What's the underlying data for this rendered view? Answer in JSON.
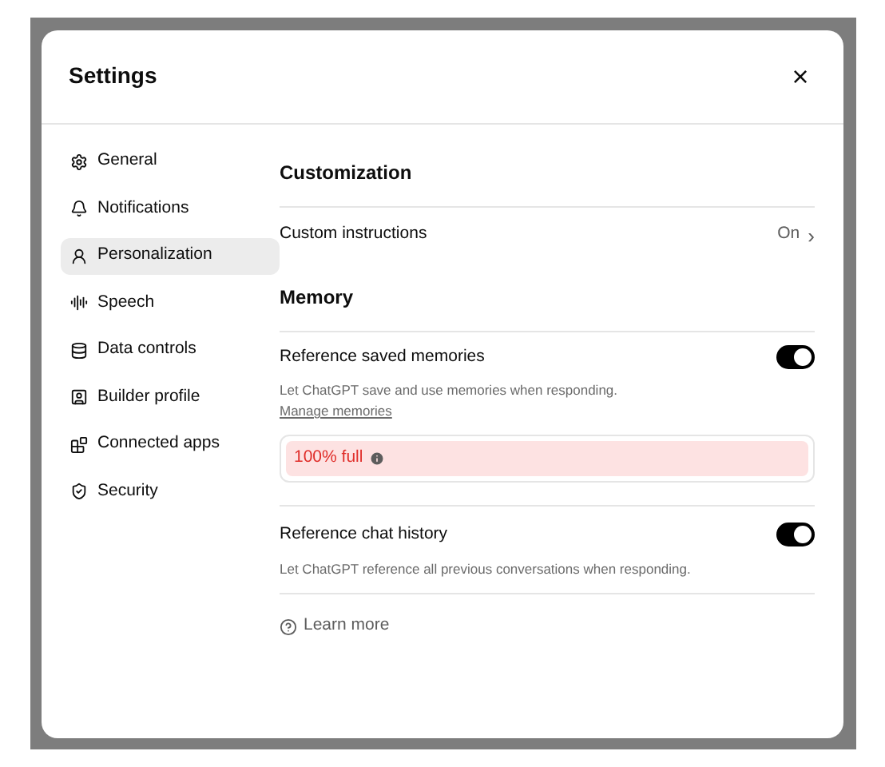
{
  "dialog": {
    "title": "Settings",
    "close": "×"
  },
  "sidebar": {
    "items": [
      {
        "label": "General",
        "selected": false
      },
      {
        "label": "Notifications",
        "selected": false
      },
      {
        "label": "Personalization",
        "selected": true
      },
      {
        "label": "Speech",
        "selected": false
      },
      {
        "label": "Data controls",
        "selected": false
      },
      {
        "label": "Builder profile",
        "selected": false
      },
      {
        "label": "Connected apps",
        "selected": false
      },
      {
        "label": "Security",
        "selected": false
      }
    ]
  },
  "customization": {
    "heading": "Customization",
    "row": {
      "label": "Custom instructions",
      "value": "On",
      "chevron": "›"
    }
  },
  "memory": {
    "heading": "Memory",
    "saved": {
      "label": "Reference saved memories",
      "on": true,
      "description": "Let ChatGPT save and use memories when responding.",
      "link": "Manage memories"
    },
    "usage": {
      "text": "100% full",
      "level": 1
    },
    "history": {
      "label": "Reference chat history",
      "on": true,
      "description": "Let ChatGPT reference all previous conversations when responding."
    }
  },
  "learn_more": "Learn more"
}
